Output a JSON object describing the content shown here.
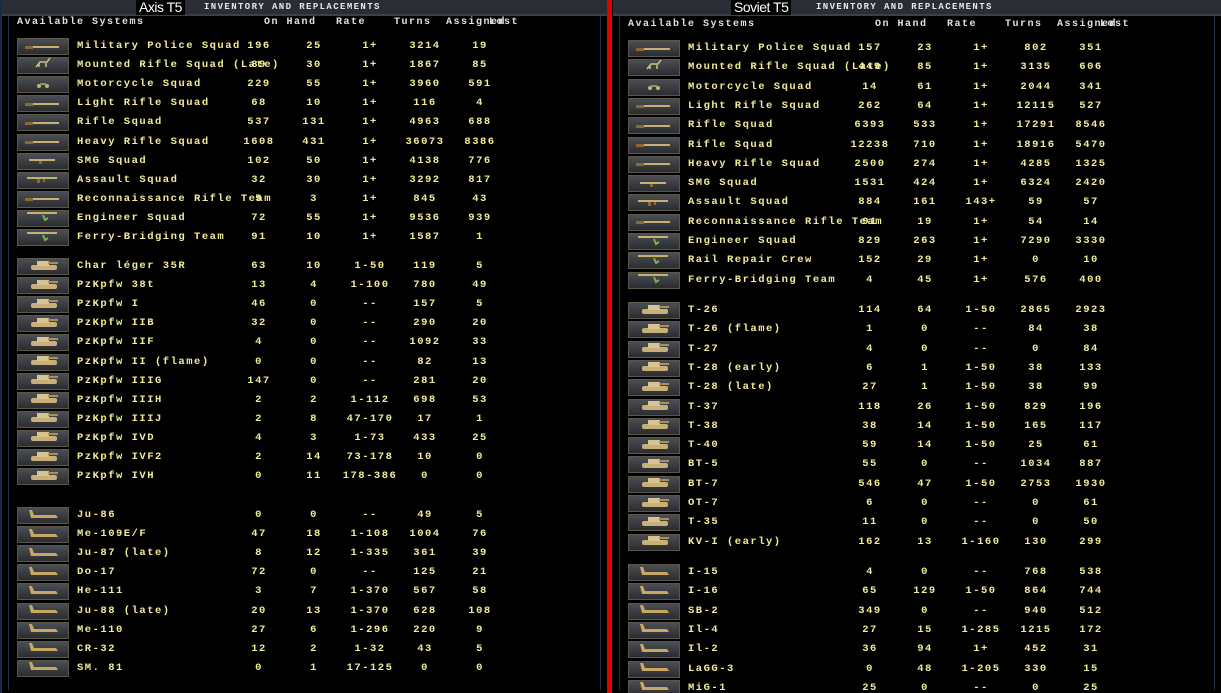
{
  "colors": {
    "text": "#f2ec98",
    "divider": "#e00000",
    "background": "#000000"
  },
  "panels": [
    {
      "title": "Axis T5",
      "header_label": "INVENTORY AND REPLACEMENTS",
      "columns": [
        "Available Systems",
        "On Hand",
        "Rate",
        "Turns",
        "Assigned",
        "Lost"
      ],
      "groups": [
        {
          "rows": [
            {
              "icon": "rifle-icon",
              "name": "Military Police Squad",
              "on_hand": "196",
              "rate": "25",
              "turns": "1+",
              "assigned": "3214",
              "lost": "19"
            },
            {
              "icon": "cavalry-icon",
              "name": "Mounted Rifle Squad (Late)",
              "on_hand": "89",
              "rate": "30",
              "turns": "1+",
              "assigned": "1867",
              "lost": "85"
            },
            {
              "icon": "motorcycle-icon",
              "name": "Motorcycle Squad",
              "on_hand": "229",
              "rate": "55",
              "turns": "1+",
              "assigned": "3960",
              "lost": "591"
            },
            {
              "icon": "rifle-icon",
              "name": "Light Rifle Squad",
              "on_hand": "68",
              "rate": "10",
              "turns": "1+",
              "assigned": "116",
              "lost": "4"
            },
            {
              "icon": "rifle-icon",
              "name": "Rifle Squad",
              "on_hand": "537",
              "rate": "131",
              "turns": "1+",
              "assigned": "4963",
              "lost": "688"
            },
            {
              "icon": "rifle-icon",
              "name": "Heavy Rifle Squad",
              "on_hand": "1608",
              "rate": "431",
              "turns": "1+",
              "assigned": "36073",
              "lost": "8386"
            },
            {
              "icon": "smg-icon",
              "name": "SMG Squad",
              "on_hand": "102",
              "rate": "50",
              "turns": "1+",
              "assigned": "4138",
              "lost": "776"
            },
            {
              "icon": "assault-rifle-icon",
              "name": "Assault Squad",
              "on_hand": "32",
              "rate": "30",
              "turns": "1+",
              "assigned": "3292",
              "lost": "817"
            },
            {
              "icon": "rifle-icon",
              "name": "Reconnaissance Rifle Team",
              "on_hand": "5",
              "rate": "3",
              "turns": "1+",
              "assigned": "845",
              "lost": "43"
            },
            {
              "icon": "engineer-icon",
              "name": "Engineer Squad",
              "on_hand": "72",
              "rate": "55",
              "turns": "1+",
              "assigned": "9536",
              "lost": "939"
            },
            {
              "icon": "engineer-icon",
              "name": "Ferry-Bridging Team",
              "on_hand": "91",
              "rate": "10",
              "turns": "1+",
              "assigned": "1587",
              "lost": "1"
            }
          ]
        },
        {
          "rows": [
            {
              "icon": "tank-icon",
              "name": "Char léger 35R",
              "on_hand": "63",
              "rate": "10",
              "turns": "1-50",
              "assigned": "119",
              "lost": "5"
            },
            {
              "icon": "tank-icon",
              "name": "PzKpfw 38t",
              "on_hand": "13",
              "rate": "4",
              "turns": "1-100",
              "assigned": "780",
              "lost": "49"
            },
            {
              "icon": "tank-icon",
              "name": "PzKpfw I",
              "on_hand": "46",
              "rate": "0",
              "turns": "--",
              "assigned": "157",
              "lost": "5"
            },
            {
              "icon": "tank-icon",
              "name": "PzKpfw IIB",
              "on_hand": "32",
              "rate": "0",
              "turns": "--",
              "assigned": "290",
              "lost": "20"
            },
            {
              "icon": "tank-icon",
              "name": "PzKpfw IIF",
              "on_hand": "4",
              "rate": "0",
              "turns": "--",
              "assigned": "1092",
              "lost": "33"
            },
            {
              "icon": "tank-icon",
              "name": "PzKpfw II (flame)",
              "on_hand": "0",
              "rate": "0",
              "turns": "--",
              "assigned": "82",
              "lost": "13"
            },
            {
              "icon": "tank-icon",
              "name": "PzKpfw IIIG",
              "on_hand": "147",
              "rate": "0",
              "turns": "--",
              "assigned": "281",
              "lost": "20"
            },
            {
              "icon": "tank-icon",
              "name": "PzKpfw IIIH",
              "on_hand": "2",
              "rate": "2",
              "turns": "1-112",
              "assigned": "698",
              "lost": "53"
            },
            {
              "icon": "tank-icon",
              "name": "PzKpfw IIIJ",
              "on_hand": "2",
              "rate": "8",
              "turns": "47-170",
              "assigned": "17",
              "lost": "1"
            },
            {
              "icon": "tank-icon",
              "name": "PzKpfw IVD",
              "on_hand": "4",
              "rate": "3",
              "turns": "1-73",
              "assigned": "433",
              "lost": "25"
            },
            {
              "icon": "tank-icon",
              "name": "PzKpfw IVF2",
              "on_hand": "2",
              "rate": "14",
              "turns": "73-178",
              "assigned": "10",
              "lost": "0"
            },
            {
              "icon": "tank-icon",
              "name": "PzKpfw IVH",
              "on_hand": "0",
              "rate": "11",
              "turns": "178-386",
              "assigned": "0",
              "lost": "0"
            }
          ]
        },
        {
          "rows": [
            {
              "icon": "aircraft-icon",
              "name": "Ju-86",
              "on_hand": "0",
              "rate": "0",
              "turns": "--",
              "assigned": "49",
              "lost": "5"
            },
            {
              "icon": "aircraft-icon",
              "name": "Me-109E/F",
              "on_hand": "47",
              "rate": "18",
              "turns": "1-108",
              "assigned": "1004",
              "lost": "76"
            },
            {
              "icon": "aircraft-icon",
              "name": "Ju-87 (late)",
              "on_hand": "8",
              "rate": "12",
              "turns": "1-335",
              "assigned": "361",
              "lost": "39"
            },
            {
              "icon": "aircraft-icon",
              "name": "Do-17",
              "on_hand": "72",
              "rate": "0",
              "turns": "--",
              "assigned": "125",
              "lost": "21"
            },
            {
              "icon": "aircraft-icon",
              "name": "He-111",
              "on_hand": "3",
              "rate": "7",
              "turns": "1-370",
              "assigned": "567",
              "lost": "58"
            },
            {
              "icon": "aircraft-icon",
              "name": "Ju-88 (late)",
              "on_hand": "20",
              "rate": "13",
              "turns": "1-370",
              "assigned": "628",
              "lost": "108"
            },
            {
              "icon": "aircraft-icon",
              "name": "Me-110",
              "on_hand": "27",
              "rate": "6",
              "turns": "1-296",
              "assigned": "220",
              "lost": "9"
            },
            {
              "icon": "aircraft-icon",
              "name": "CR-32",
              "on_hand": "12",
              "rate": "2",
              "turns": "1-32",
              "assigned": "43",
              "lost": "5"
            },
            {
              "icon": "aircraft-icon",
              "name": "SM. 81",
              "on_hand": "0",
              "rate": "1",
              "turns": "17-125",
              "assigned": "0",
              "lost": "0"
            }
          ]
        }
      ]
    },
    {
      "title": "Soviet T5",
      "header_label": "INVENTORY AND REPLACEMENTS",
      "columns": [
        "Available Systems",
        "On Hand",
        "Rate",
        "Turns",
        "Assigned",
        "Lost"
      ],
      "groups": [
        {
          "rows": [
            {
              "icon": "rifle-icon",
              "name": "Military Police Squad",
              "on_hand": "157",
              "rate": "23",
              "turns": "1+",
              "assigned": "802",
              "lost": "351"
            },
            {
              "icon": "cavalry-icon",
              "name": "Mounted Rifle Squad (Late)",
              "on_hand": "449",
              "rate": "85",
              "turns": "1+",
              "assigned": "3135",
              "lost": "606"
            },
            {
              "icon": "motorcycle-icon",
              "name": "Motorcycle Squad",
              "on_hand": "14",
              "rate": "61",
              "turns": "1+",
              "assigned": "2044",
              "lost": "341"
            },
            {
              "icon": "rifle-icon",
              "name": "Light Rifle Squad",
              "on_hand": "262",
              "rate": "64",
              "turns": "1+",
              "assigned": "12115",
              "lost": "527"
            },
            {
              "icon": "rifle-icon",
              "name": "Rifle Squad",
              "on_hand": "6393",
              "rate": "533",
              "turns": "1+",
              "assigned": "17291",
              "lost": "8546"
            },
            {
              "icon": "rifle-icon",
              "name": "Rifle Squad",
              "on_hand": "12238",
              "rate": "710",
              "turns": "1+",
              "assigned": "18916",
              "lost": "5470"
            },
            {
              "icon": "rifle-icon",
              "name": "Heavy Rifle Squad",
              "on_hand": "2500",
              "rate": "274",
              "turns": "1+",
              "assigned": "4285",
              "lost": "1325"
            },
            {
              "icon": "smg-icon",
              "name": "SMG Squad",
              "on_hand": "1531",
              "rate": "424",
              "turns": "1+",
              "assigned": "6324",
              "lost": "2420"
            },
            {
              "icon": "assault-rifle-icon",
              "name": "Assault Squad",
              "on_hand": "884",
              "rate": "161",
              "turns": "143+",
              "assigned": "59",
              "lost": "57"
            },
            {
              "icon": "rifle-icon",
              "name": "Reconnaissance Rifle Team",
              "on_hand": "91",
              "rate": "19",
              "turns": "1+",
              "assigned": "54",
              "lost": "14"
            },
            {
              "icon": "engineer-icon",
              "name": "Engineer Squad",
              "on_hand": "829",
              "rate": "263",
              "turns": "1+",
              "assigned": "7290",
              "lost": "3330"
            },
            {
              "icon": "engineer-icon",
              "name": "Rail Repair Crew",
              "on_hand": "152",
              "rate": "29",
              "turns": "1+",
              "assigned": "0",
              "lost": "10"
            },
            {
              "icon": "engineer-icon",
              "name": "Ferry-Bridging Team",
              "on_hand": "4",
              "rate": "45",
              "turns": "1+",
              "assigned": "576",
              "lost": "400"
            }
          ]
        },
        {
          "rows": [
            {
              "icon": "tank-icon",
              "name": "T-26",
              "on_hand": "114",
              "rate": "64",
              "turns": "1-50",
              "assigned": "2865",
              "lost": "2923"
            },
            {
              "icon": "tank-icon",
              "name": "T-26 (flame)",
              "on_hand": "1",
              "rate": "0",
              "turns": "--",
              "assigned": "84",
              "lost": "38"
            },
            {
              "icon": "tank-icon",
              "name": "T-27",
              "on_hand": "4",
              "rate": "0",
              "turns": "--",
              "assigned": "0",
              "lost": "84"
            },
            {
              "icon": "tank-icon",
              "name": "T-28 (early)",
              "on_hand": "6",
              "rate": "1",
              "turns": "1-50",
              "assigned": "38",
              "lost": "133"
            },
            {
              "icon": "tank-icon",
              "name": "T-28 (late)",
              "on_hand": "27",
              "rate": "1",
              "turns": "1-50",
              "assigned": "38",
              "lost": "99"
            },
            {
              "icon": "tank-icon",
              "name": "T-37",
              "on_hand": "118",
              "rate": "26",
              "turns": "1-50",
              "assigned": "829",
              "lost": "196"
            },
            {
              "icon": "tank-icon",
              "name": "T-38",
              "on_hand": "38",
              "rate": "14",
              "turns": "1-50",
              "assigned": "165",
              "lost": "117"
            },
            {
              "icon": "tank-icon",
              "name": "T-40",
              "on_hand": "59",
              "rate": "14",
              "turns": "1-50",
              "assigned": "25",
              "lost": "61"
            },
            {
              "icon": "tank-icon",
              "name": "BT-5",
              "on_hand": "55",
              "rate": "0",
              "turns": "--",
              "assigned": "1034",
              "lost": "887"
            },
            {
              "icon": "tank-icon",
              "name": "BT-7",
              "on_hand": "546",
              "rate": "47",
              "turns": "1-50",
              "assigned": "2753",
              "lost": "1930"
            },
            {
              "icon": "tank-icon",
              "name": "OT-7",
              "on_hand": "6",
              "rate": "0",
              "turns": "--",
              "assigned": "0",
              "lost": "61"
            },
            {
              "icon": "tank-icon",
              "name": "T-35",
              "on_hand": "11",
              "rate": "0",
              "turns": "--",
              "assigned": "0",
              "lost": "50"
            },
            {
              "icon": "tank-icon",
              "name": "KV-I (early)",
              "on_hand": "162",
              "rate": "13",
              "turns": "1-160",
              "assigned": "130",
              "lost": "299"
            }
          ]
        },
        {
          "rows": [
            {
              "icon": "aircraft-icon",
              "name": "I-15",
              "on_hand": "4",
              "rate": "0",
              "turns": "--",
              "assigned": "768",
              "lost": "538"
            },
            {
              "icon": "aircraft-icon",
              "name": "I-16",
              "on_hand": "65",
              "rate": "129",
              "turns": "1-50",
              "assigned": "864",
              "lost": "744"
            },
            {
              "icon": "aircraft-icon",
              "name": "SB-2",
              "on_hand": "349",
              "rate": "0",
              "turns": "--",
              "assigned": "940",
              "lost": "512"
            },
            {
              "icon": "aircraft-icon",
              "name": "Il-4",
              "on_hand": "27",
              "rate": "15",
              "turns": "1-285",
              "assigned": "1215",
              "lost": "172"
            },
            {
              "icon": "aircraft-icon",
              "name": "Il-2",
              "on_hand": "36",
              "rate": "94",
              "turns": "1+",
              "assigned": "452",
              "lost": "31"
            },
            {
              "icon": "aircraft-icon",
              "name": "LaGG-3",
              "on_hand": "0",
              "rate": "48",
              "turns": "1-205",
              "assigned": "330",
              "lost": "15"
            },
            {
              "icon": "aircraft-icon",
              "name": "MiG-1",
              "on_hand": "25",
              "rate": "0",
              "turns": "--",
              "assigned": "0",
              "lost": "25"
            }
          ]
        }
      ]
    }
  ]
}
